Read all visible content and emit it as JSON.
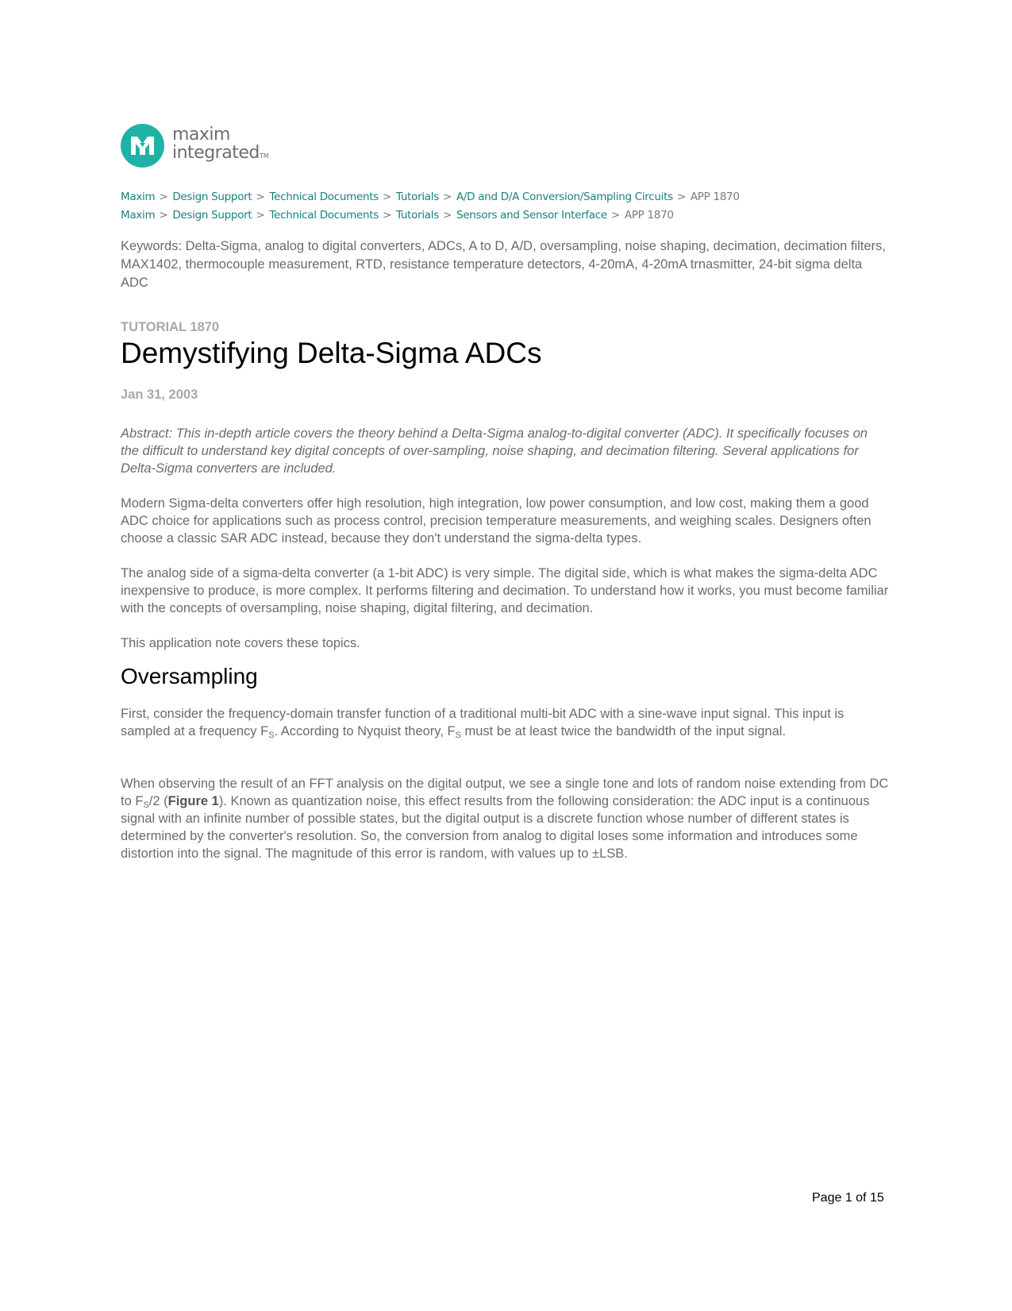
{
  "logo": {
    "line1": "maxim",
    "line2": "integrated",
    "tm": "TM",
    "brand_color": "#1fb3a5",
    "icon": "maxim-logo-icon"
  },
  "breadcrumbs": [
    {
      "items": [
        "Maxim",
        "Design Support",
        "Technical Documents",
        "Tutorials",
        "A/D and D/A Conversion/Sampling Circuits"
      ],
      "current": "APP 1870"
    },
    {
      "items": [
        "Maxim",
        "Design Support",
        "Technical Documents",
        "Tutorials",
        "Sensors and Sensor Interface"
      ],
      "current": "APP 1870"
    }
  ],
  "breadcrumb_separator": ">",
  "link_color": "#1a7f80",
  "keywords": "Keywords: Delta-Sigma, analog to digital converters, ADCs, A to D, A/D, oversampling, noise shaping, decimation, decimation filters, MAX1402, thermocouple measurement, RTD, resistance temperature detectors, 4-20mA, 4-20mA trnasmitter, 24-bit sigma delta ADC",
  "tutorial_label": "TUTORIAL 1870",
  "title": "Demystifying Delta-Sigma ADCs",
  "date": "Jan 31, 2003",
  "abstract": "Abstract: This in-depth article covers the theory behind a Delta-Sigma analog-to-digital converter (ADC). It specifically focuses on the difficult to understand key digital concepts of over-sampling, noise shaping, and decimation filtering. Several applications for Delta-Sigma converters are included.",
  "paragraphs": {
    "p1": "Modern Sigma-delta converters offer high resolution, high integration, low power consumption, and low cost, making them a good ADC choice for applications such as process control, precision temperature measurements, and weighing scales. Designers often choose a classic SAR ADC instead, because they don't understand the sigma-delta types.",
    "p2": "The analog side of a sigma-delta converter (a 1-bit ADC) is very simple. The digital side, which is what makes the sigma-delta ADC inexpensive to produce, is more complex. It performs filtering and decimation. To understand how it works, you must become familiar with the concepts of oversampling, noise shaping, digital filtering, and decimation.",
    "p3": "This application note covers these topics."
  },
  "section": {
    "heading": "Oversampling",
    "p4": {
      "a": "First, consider the frequency-domain transfer function of a traditional multi-bit ADC with a sine-wave input signal. This input is sampled at a frequency F",
      "sub1": "S",
      "b": ". According to Nyquist theory, F",
      "sub2": "S",
      "c": " must be at least twice the bandwidth of the input signal."
    },
    "p5": {
      "a": "When observing the result of an FFT analysis on the digital output, we see a single tone and lots of random noise extending from DC to F",
      "sub": "S",
      "b": "/2 (",
      "figure_ref": "Figure 1",
      "c": "). Known as quantization noise, this effect results from the following consideration: the ADC input is a continuous signal with an infinite number of possible states, but the digital output is a discrete function whose number of different states is determined by the converter's resolution. So, the conversion from analog to digital loses some information and introduces some distortion into the signal. The magnitude of this error is random, with values up to ±LSB."
    }
  },
  "footer": {
    "page_label": "Page 1 of 15"
  }
}
